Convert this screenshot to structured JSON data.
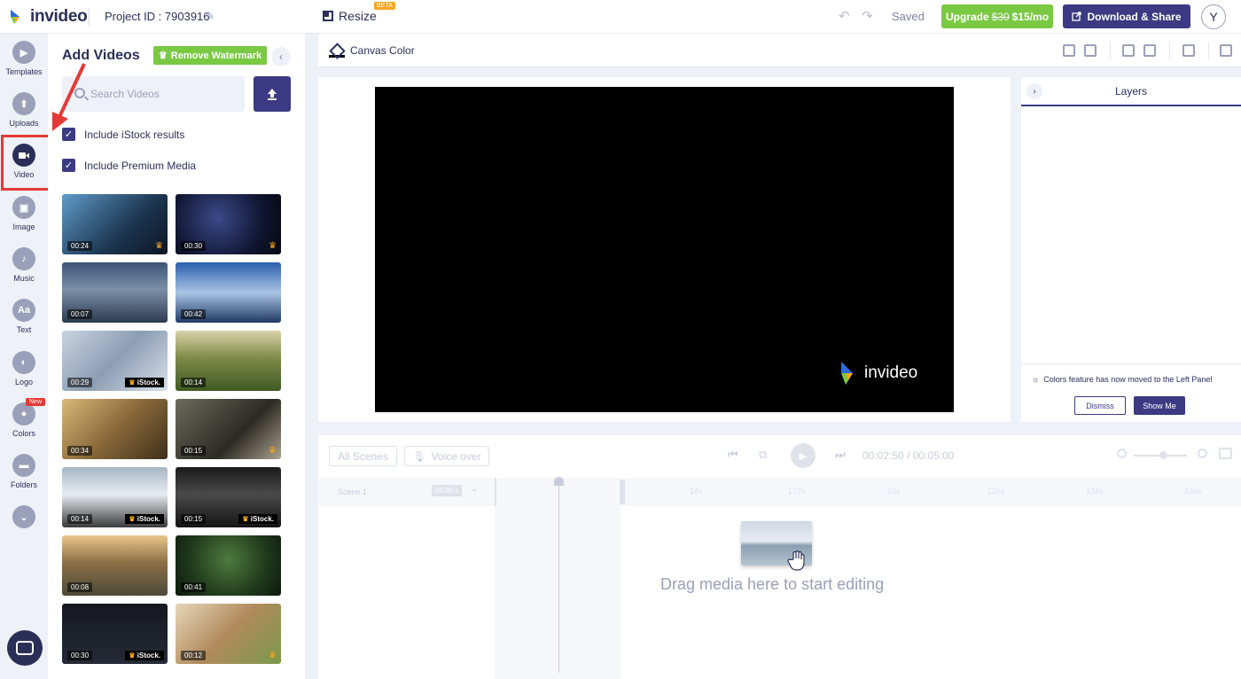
{
  "header": {
    "logo_text": "invideo",
    "project_id": "Project ID : 7903916",
    "resize_label": "Resize",
    "beta_badge": "BETA",
    "saved": "Saved",
    "upgrade_prefix": "Upgrade",
    "upgrade_old_price": "$30",
    "upgrade_price": "$15/mo",
    "download_label": "Download & Share",
    "avatar_letter": "Y"
  },
  "rail": {
    "items": [
      {
        "label": "Templates",
        "icon": "templates-icon"
      },
      {
        "label": "Uploads",
        "icon": "upload-icon"
      },
      {
        "label": "Video",
        "icon": "video-icon"
      },
      {
        "label": "Image",
        "icon": "image-icon"
      },
      {
        "label": "Music",
        "icon": "music-icon"
      },
      {
        "label": "Text",
        "icon": "text-icon",
        "glyph": "Aa"
      },
      {
        "label": "Logo",
        "icon": "logo-icon"
      },
      {
        "label": "Colors",
        "icon": "palette-icon"
      },
      {
        "label": "Folders",
        "icon": "folder-icon"
      }
    ],
    "new_badge": "New",
    "active": "Video"
  },
  "panel": {
    "title": "Add Videos",
    "remove_watermark": "Remove Watermark",
    "search_placeholder": "Search Videos",
    "include_istock": "Include iStock results",
    "include_premium": "Include Premium Media",
    "istock_label": "iStock.",
    "thumbnails": [
      {
        "duration": "00:24",
        "badge": "crown"
      },
      {
        "duration": "00:30",
        "badge": "crown"
      },
      {
        "duration": "00:07",
        "badge": ""
      },
      {
        "duration": "00:42",
        "badge": ""
      },
      {
        "duration": "00:29",
        "badge": "istock"
      },
      {
        "duration": "00:14",
        "badge": ""
      },
      {
        "duration": "00:34",
        "badge": ""
      },
      {
        "duration": "00:15",
        "badge": "crown"
      },
      {
        "duration": "00:14",
        "badge": "istock"
      },
      {
        "duration": "00:15",
        "badge": "istock"
      },
      {
        "duration": "00:08",
        "badge": ""
      },
      {
        "duration": "00:41",
        "badge": ""
      },
      {
        "duration": "00:30",
        "badge": "istock"
      },
      {
        "duration": "00:12",
        "badge": "crown"
      }
    ]
  },
  "canvas_bar": {
    "canvas_color": "Canvas Color"
  },
  "canvas": {
    "watermark": "invideo",
    "background": "#000000"
  },
  "layers": {
    "title": "Layers",
    "notice": "Colors feature has now moved to the Left Panel",
    "dismiss": "Dismiss",
    "show_me": "Show Me"
  },
  "timeline": {
    "all_scenes": "All Scenes",
    "voice_over": "Voice over",
    "current_time": "00:02:50",
    "separator": "/",
    "total_time": "00:05:00",
    "scene_label": "Scene 1",
    "scene_duration": "05:00 s",
    "ticks": [
      "0s",
      "14s",
      "14s",
      "172s",
      "10s",
      "126s",
      "134s",
      "136s"
    ],
    "drag_text": "Drag media here to start editing"
  },
  "colors": {
    "accent": "#3b3a82",
    "green": "#7ac943",
    "text": "#2b2f58",
    "annotation_red": "#e53935"
  }
}
